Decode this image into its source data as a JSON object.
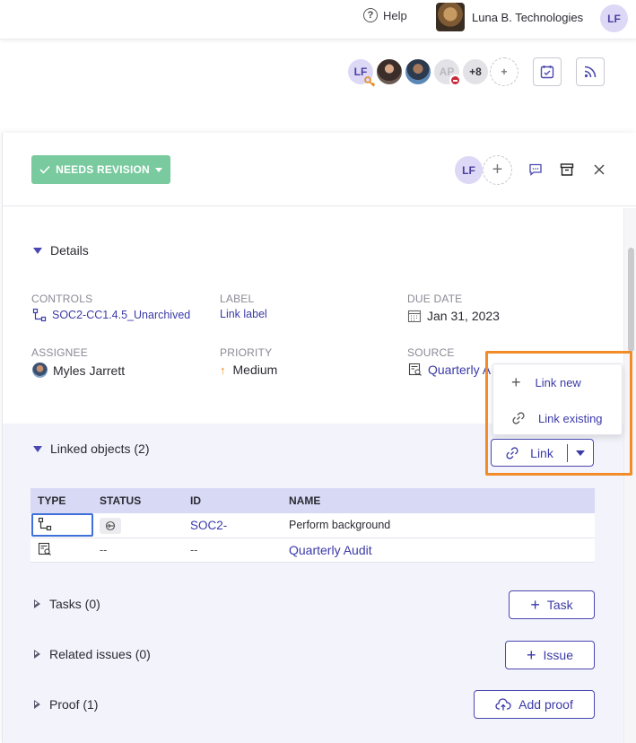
{
  "topbar": {
    "help_label": "Help",
    "org_name": "Luna B. Technologies",
    "user_initials": "LF"
  },
  "collaborators": {
    "initials_1": "LF",
    "initials_4": "AP",
    "more_count": "+8",
    "add_symbol": "+"
  },
  "header": {
    "status_label": "NEEDS REVISION",
    "assignee_initials": "LF",
    "add_symbol": "+"
  },
  "details": {
    "title": "Details",
    "controls_label": "CONTROLS",
    "controls_value": "SOC2-CC1.4.5_Unarchived",
    "label_label": "LABEL",
    "label_value": "Link label",
    "due_label": "DUE DATE",
    "due_value": "Jan 31, 2023",
    "assignee_label": "ASSIGNEE",
    "assignee_value": "Myles Jarrett",
    "priority_label": "PRIORITY",
    "priority_value": "Medium",
    "source_label": "SOURCE",
    "source_value": "Quarterly A"
  },
  "linked": {
    "title": "Linked objects (2)",
    "columns": [
      "TYPE",
      "STATUS",
      "ID",
      "NAME"
    ],
    "rows": [
      {
        "status": "",
        "id": "SOC2-",
        "name": "Perform background"
      },
      {
        "status": "--",
        "id": "--",
        "name": "Quarterly Audit"
      }
    ],
    "link_button": "Link",
    "menu": {
      "link_new": "Link new",
      "link_existing": "Link existing"
    }
  },
  "tasks": {
    "title": "Tasks (0)",
    "button": "Task"
  },
  "issues": {
    "title": "Related issues (0)",
    "button": "Issue"
  },
  "proof": {
    "title": "Proof (1)",
    "button": "Add proof"
  },
  "colors": {
    "accent": "#4a47b0",
    "status_green": "#79ca9e",
    "highlight": "#f28c28",
    "table_header": "#d8d9f4"
  }
}
